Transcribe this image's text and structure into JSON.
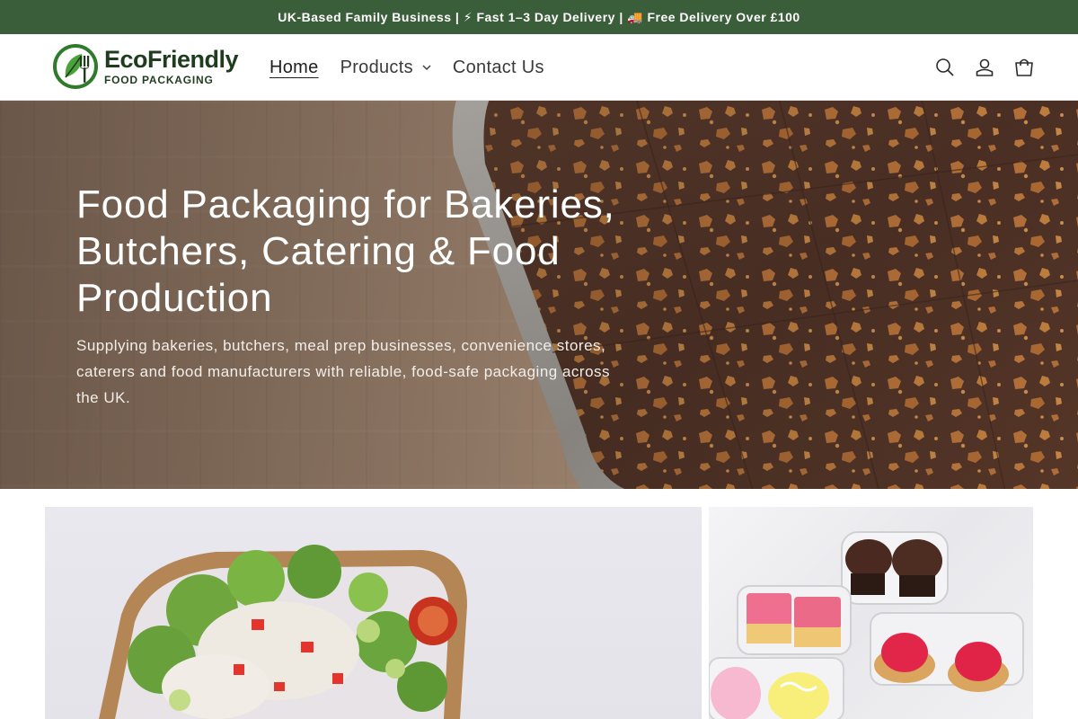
{
  "announcement": {
    "text": "UK-Based Family Business | ⚡ Fast 1–3 Day Delivery | 🚚 Free Delivery Over £100"
  },
  "header": {
    "logo": {
      "name": "EcoFriendly",
      "tagline": "FOOD PACKAGING"
    },
    "nav": [
      {
        "label": "Home",
        "active": true
      },
      {
        "label": "Products",
        "has_dropdown": true
      },
      {
        "label": "Contact Us"
      }
    ],
    "icons": [
      "search-icon",
      "account-icon",
      "cart-icon"
    ]
  },
  "hero": {
    "title": "Food Packaging for Bakeries, Butchers, Catering & Food Production",
    "text": "Supplying bakeries, butchers, meal prep businesses, convenience stores, caterers and food manufacturers with reliable, food-safe packaging across the UK."
  },
  "colors": {
    "brand_green": "#3b5e3a",
    "logo_green": "#1f3d1e",
    "text_dark": "#1f1f1f"
  }
}
